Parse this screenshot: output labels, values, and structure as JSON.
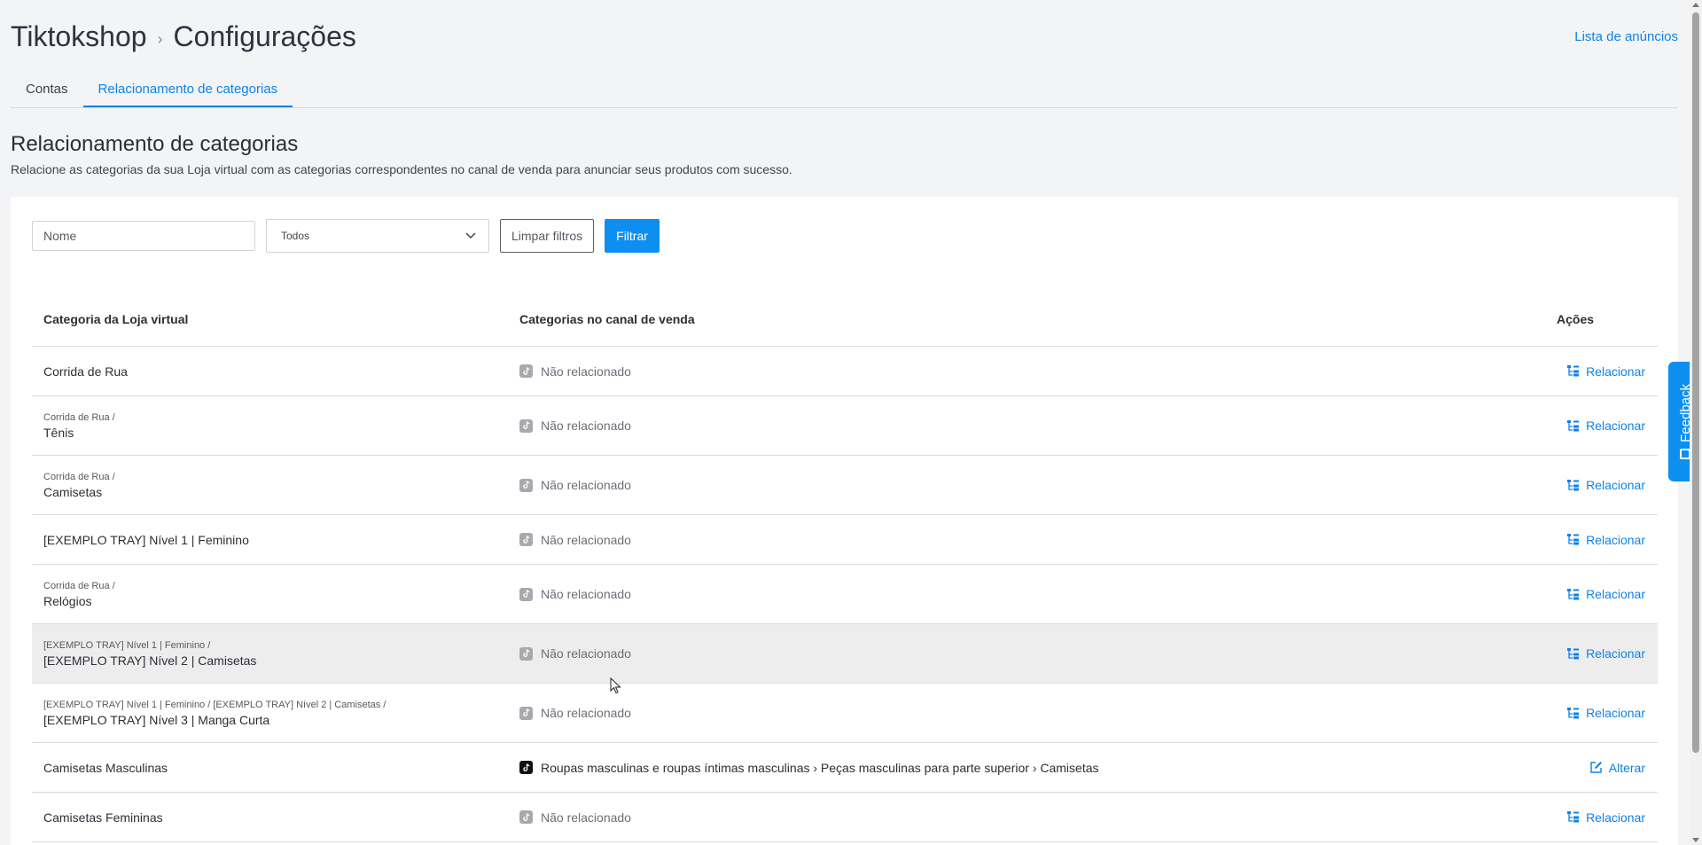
{
  "breadcrumb": {
    "root": "Tiktokshop",
    "separator": "›",
    "current": "Configurações"
  },
  "top_link": "Lista de anúncios",
  "tabs": [
    {
      "label": "Contas",
      "active": false
    },
    {
      "label": "Relacionamento de categorias",
      "active": true
    }
  ],
  "section": {
    "title": "Relacionamento de categorias",
    "description": "Relacione as categorias da sua Loja virtual com as categorias correspondentes no canal de venda para anunciar seus produtos com sucesso."
  },
  "filters": {
    "name_placeholder": "Nome",
    "select_value": "Todos",
    "clear_label": "Limpar filtros",
    "filter_label": "Filtrar"
  },
  "table": {
    "headers": {
      "store_category": "Categoria da Loja virtual",
      "channel_category": "Categorias no canal de venda",
      "actions": "Ações"
    },
    "rows": [
      {
        "path": "",
        "name": "Corrida de Rua",
        "status": "Não relacionado",
        "action": "Relacionar"
      },
      {
        "path": "Corrida de Rua /",
        "name": "Tênis",
        "status": "Não relacionado",
        "action": "Relacionar"
      },
      {
        "path": "Corrida de Rua /",
        "name": "Camisetas",
        "status": "Não relacionado",
        "action": "Relacionar"
      },
      {
        "path": "",
        "name": "[EXEMPLO TRAY] Nível 1 | Feminino",
        "status": "Não relacionado",
        "action": "Relacionar"
      },
      {
        "path": "Corrida de Rua /",
        "name": "Relógios",
        "status": "Não relacionado",
        "action": "Relacionar"
      },
      {
        "path": "[EXEMPLO TRAY] Nível 1 | Feminino /",
        "name": "[EXEMPLO TRAY] Nível 2 | Camisetas",
        "status": "Não relacionado",
        "action": "Relacionar"
      },
      {
        "path": "[EXEMPLO TRAY] Nível 1 | Feminino / [EXEMPLO TRAY] Nível 2 | Camisetas /",
        "name": "[EXEMPLO TRAY] Nível 3 | Manga Curta",
        "status": "Não relacionado",
        "action": "Relacionar"
      },
      {
        "path": "",
        "name": "Camisetas Masculinas",
        "status": "Roupas masculinas e roupas íntimas masculinas › Peças masculinas para parte superior › Camisetas",
        "action": "Alterar"
      },
      {
        "path": "",
        "name": "Camisetas Femininas",
        "status": "Não relacionado",
        "action": "Relacionar"
      }
    ]
  },
  "feedback_label": "Feedback",
  "colors": {
    "accent": "#0d8ff2",
    "link": "#0e82e8"
  }
}
